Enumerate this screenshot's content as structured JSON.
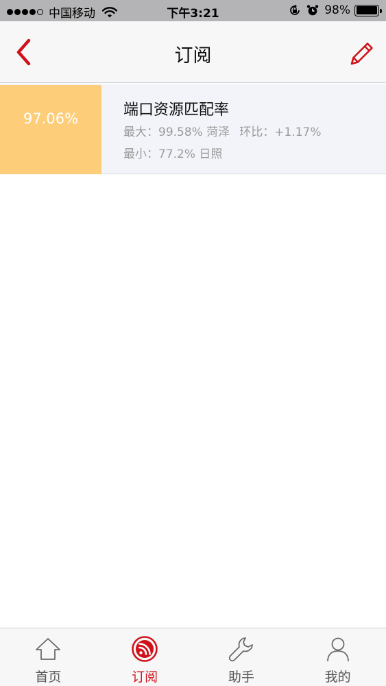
{
  "status_bar": {
    "carrier": "中国移动",
    "time": "下午3:21",
    "battery_percent": "98%",
    "battery_level": 0.98,
    "signal_bars_filled": 4,
    "signal_bars_total": 5
  },
  "nav": {
    "title": "订阅",
    "back_icon": "chevron-left-icon",
    "edit_icon": "pencil-icon",
    "accent_color": "#d0121b"
  },
  "subscriptions": [
    {
      "badge_value": "97.06%",
      "badge_color": "#fdcd79",
      "title": "端口资源匹配率",
      "max_label": "最大：",
      "max_value": "99.58%",
      "max_city": "菏泽",
      "ratio_label": "环比：",
      "ratio_value": "+1.17%",
      "min_label": "最小：",
      "min_value": "77.2%",
      "min_city": "日照"
    }
  ],
  "tabs": [
    {
      "label": "首页",
      "icon": "home-icon",
      "active": false
    },
    {
      "label": "订阅",
      "icon": "rss-icon",
      "active": true
    },
    {
      "label": "助手",
      "icon": "wrench-icon",
      "active": false
    },
    {
      "label": "我的",
      "icon": "user-icon",
      "active": false
    }
  ]
}
